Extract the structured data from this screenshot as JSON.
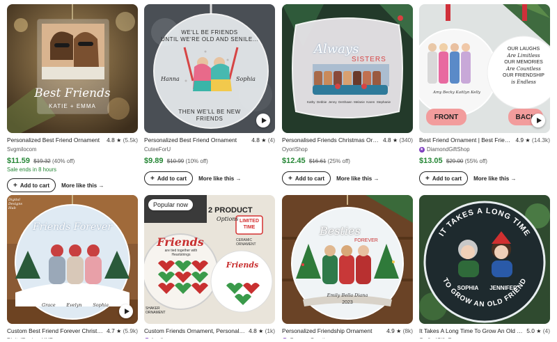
{
  "listings": [
    {
      "title": "Personalized Best Friend Ornament",
      "rating": "4.8",
      "reviews": "(5.5k)",
      "shop": "Svgmilocom",
      "price": "$11.59",
      "original_price": "$19.32",
      "discount": "(40% off)",
      "sale_note": "Sale ends in 8 hours",
      "image_text": {
        "line1": "Best",
        "line2": "Friends",
        "names": "KATIE + EMMA"
      }
    },
    {
      "title": "Personalized Best Friend Ornament",
      "rating": "4.8",
      "reviews": "(4)",
      "shop": "CuteeForU",
      "price": "$9.89",
      "original_price": "$10.99",
      "discount": "(10% off)",
      "image_text": {
        "top1": "WE'LL BE FRIENDS",
        "top2": "UNTIL WE'RE OLD AND SENILE...",
        "name1": "Hanna",
        "name2": "Sophia",
        "bottom1": "THEN WE'LL BE NEW",
        "bottom2": "FRIENDS"
      }
    },
    {
      "title": "Personalised Friends Christmas Ornament",
      "rating": "4.8",
      "reviews": "(340)",
      "shop": "OyoriShop",
      "price": "$12.45",
      "original_price": "$16.61",
      "discount": "(25% off)",
      "image_text": {
        "line1": "Always",
        "line2": "SISTERS",
        "names": [
          "Kathy",
          "Debbie",
          "Jenny",
          "DeShawn",
          "Melanie",
          "Karen",
          "Stephanie"
        ]
      }
    },
    {
      "title": "Best Friend Ornament | Best Friend Gift",
      "rating": "4.9",
      "reviews": "(14.3k)",
      "shop": "DiamondGiftShop",
      "star_seller": true,
      "price": "$13.05",
      "original_price": "$29.00",
      "discount": "(55% off)",
      "image_text": {
        "names": "Amy  Becky  Kaitlyn  Kelly",
        "quote": [
          "OUR LAUGHS",
          "Are Limitless",
          "OUR MEMORIES",
          "Are Countless",
          "OUR FRIENDSHIP",
          "is Endless"
        ],
        "front": "FRONT",
        "back": "BACK"
      }
    },
    {
      "title": "Custom Best Friend Forever Christmas Ornament",
      "rating": "4.7",
      "reviews": "(5.9k)",
      "shop": "DigitalDesignsHUB",
      "image_text": {
        "line1": "Friends Forever",
        "names": [
          "Grace",
          "Evelyn",
          "Sophia"
        ],
        "corner": "Digital Designs Hub"
      }
    },
    {
      "title": "Custom Friends Ornament, Personalized Gift",
      "rating": "4.8",
      "reviews": "(1k)",
      "shop": "Luvilooom",
      "star_seller": true,
      "badge": "Popular now",
      "image_text": {
        "product": "2 PRODUCT",
        "options": "Options",
        "limited1": "LIMITED",
        "limited2": "TIME",
        "ceramic1": "CERAMIC",
        "ceramic2": "ORNAMENT",
        "friends": "Friends",
        "tied": "are tied together with Heartstrings",
        "shaker1": "SHAKER",
        "shaker2": "ORNAMENT",
        "hearts": [
          "Kelly",
          "Nicky",
          "Ava",
          "Olivia",
          "Emily",
          "Madi",
          "Nora",
          "Zoe",
          "Lily",
          "Mia",
          "Sara",
          "Grace",
          "Ella",
          "Kim",
          "Jen"
        ]
      }
    },
    {
      "title": "Personalized Friendship Ornament",
      "rating": "4.9",
      "reviews": "(8k)",
      "shop": "GuzmanCreations",
      "star_seller": true,
      "image_text": {
        "line1": "Besties",
        "line2": "FOREVER",
        "names": "Emily   Bella   Diana",
        "year": "2023"
      }
    },
    {
      "title": "It Takes A Long Time To Grow An Old Friend Ornament",
      "rating": "5.0",
      "reviews": "(4)",
      "shop": "CraftedGiftsFam",
      "image_text": {
        "arc_top": "IT TAKES A LONG TIME",
        "arc_bottom": "TO GROW AN OLD FRIEND",
        "name1": "SOPHIA",
        "name2": "JENNIFER"
      }
    }
  ],
  "labels": {
    "add_to_cart": "Add to cart",
    "more_like_this": "More like this"
  },
  "colors": {
    "price_green": "#258635",
    "star_seller_purple": "#7f3fbf"
  }
}
